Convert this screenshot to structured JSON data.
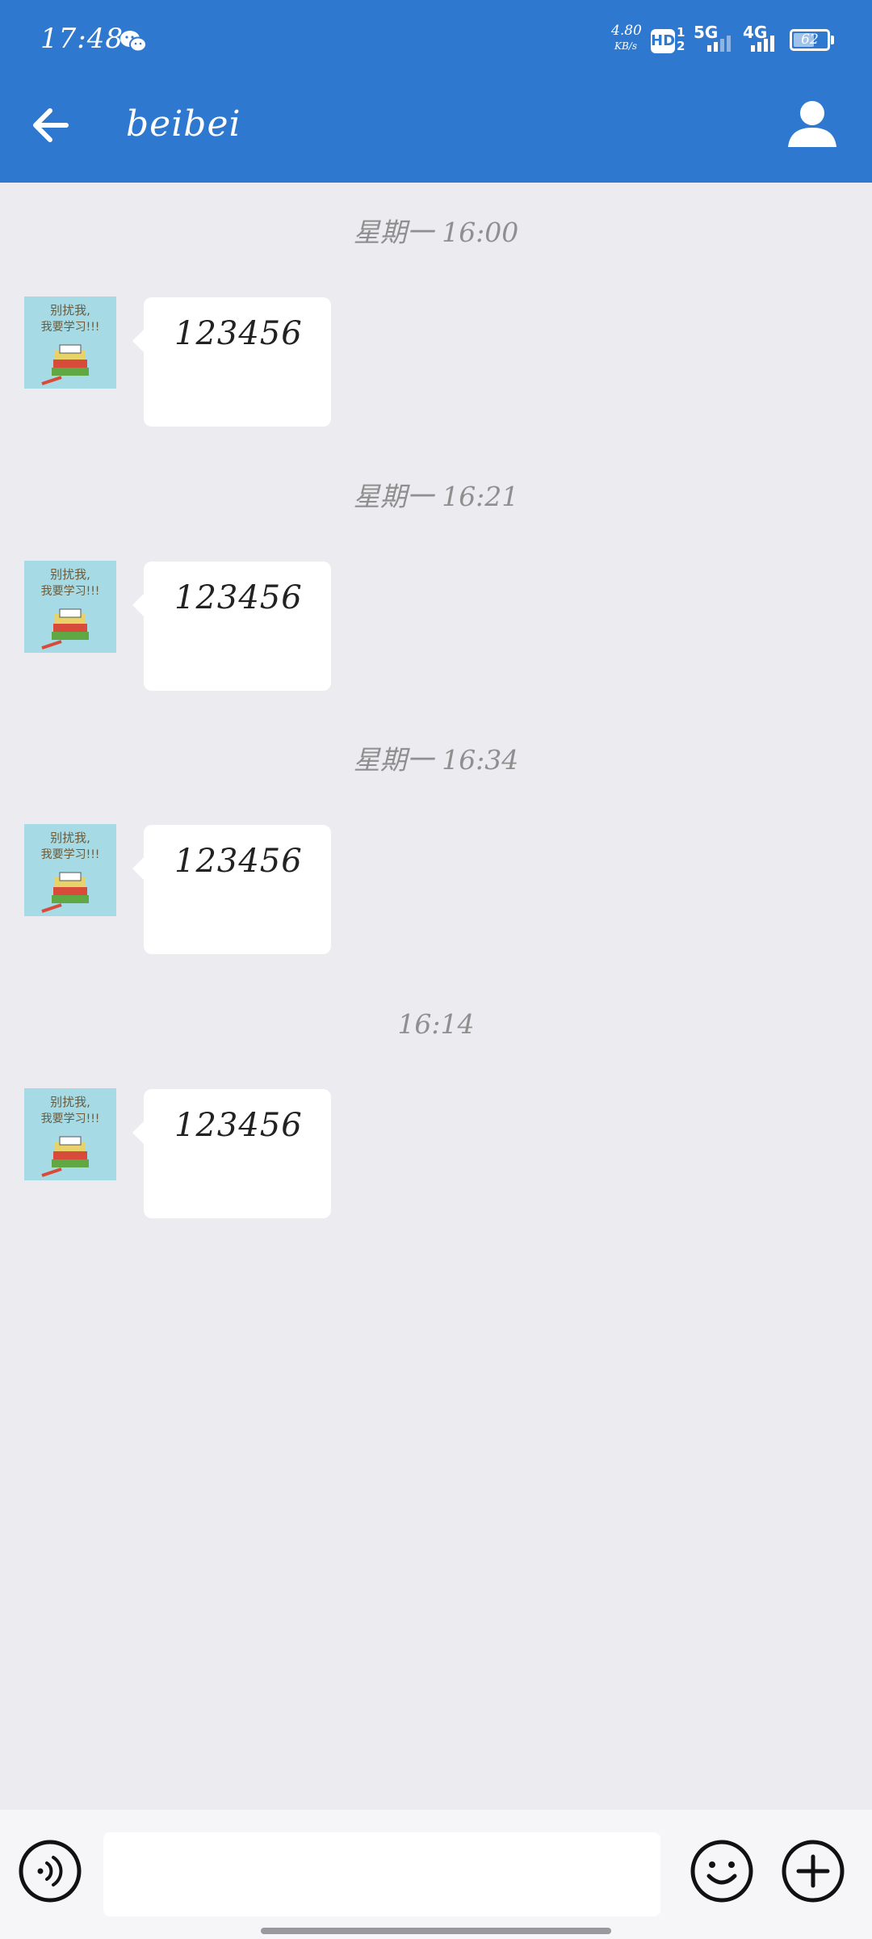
{
  "status_bar": {
    "time": "17:48",
    "app_icon": "wechat-icon",
    "net_speed_value": "4.80",
    "net_speed_unit": "KB/s",
    "hd_label": "HD",
    "hd_sims": "1 2",
    "net_5g": "5G",
    "net_4g": "4G",
    "battery": "62",
    "battery_level": 0.62
  },
  "header": {
    "back_icon": "arrow-left-icon",
    "title": "beibei",
    "profile_icon": "person-icon",
    "color": "#2f78cf"
  },
  "messages": [
    {
      "timestamp": "星期一 16:00",
      "text": "123456",
      "avatar_text": "别扰我,我要学习!!!"
    },
    {
      "timestamp": "星期一 16:21",
      "text": "123456",
      "avatar_text": "别扰我,我要学习!!!"
    },
    {
      "timestamp": "星期一 16:34",
      "text": "123456",
      "avatar_text": "别扰我,我要学习!!!"
    },
    {
      "timestamp": "16:14",
      "text": "123456",
      "avatar_text": "别扰我,我要学习!!!"
    }
  ],
  "input_bar": {
    "voice_icon": "voice-icon",
    "input_value": "",
    "input_placeholder": "",
    "emoji_icon": "smiley-icon",
    "plus_icon": "plus-circle-icon"
  }
}
